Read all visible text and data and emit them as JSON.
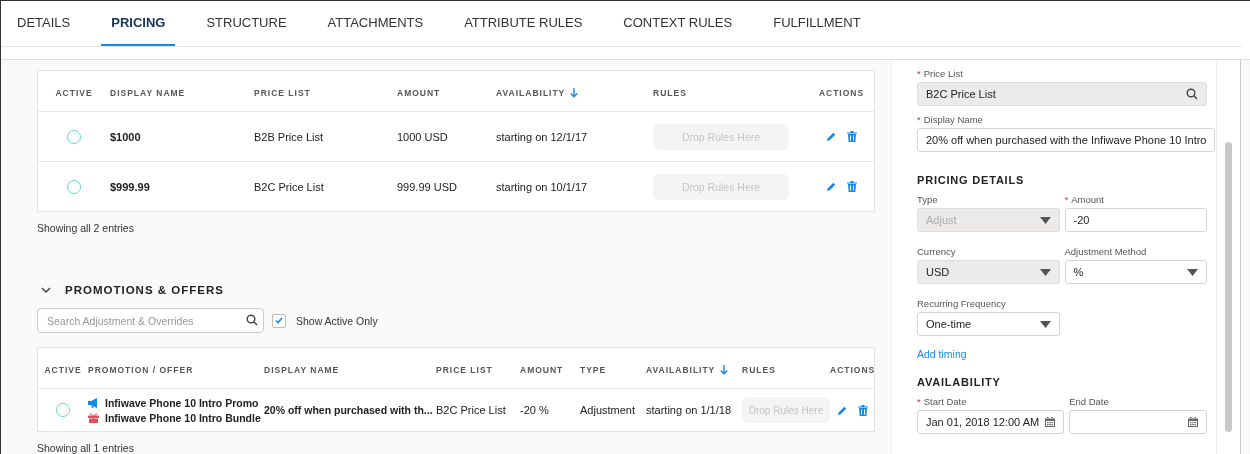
{
  "tabs": [
    {
      "label": "DETAILS",
      "selected": false
    },
    {
      "label": "PRICING",
      "selected": true
    },
    {
      "label": "STRUCTURE",
      "selected": false
    },
    {
      "label": "ATTACHMENTS",
      "selected": false
    },
    {
      "label": "ATTRIBUTE RULES",
      "selected": false
    },
    {
      "label": "CONTEXT RULES",
      "selected": false
    },
    {
      "label": "FULFILLMENT",
      "selected": false
    }
  ],
  "price_table": {
    "columns": [
      {
        "label": "ACTIVE",
        "sorted": false
      },
      {
        "label": "DISPLAY NAME",
        "sorted": false
      },
      {
        "label": "PRICE LIST",
        "sorted": false
      },
      {
        "label": "AMOUNT",
        "sorted": false
      },
      {
        "label": "AVAILABILITY",
        "sorted": true
      },
      {
        "label": "RULES",
        "sorted": false
      },
      {
        "label": "ACTIONS",
        "sorted": false
      }
    ],
    "rows": [
      {
        "active": false,
        "display_name": "$1000",
        "price_list": "B2B Price List",
        "amount": "1000 USD",
        "availability": "starting on 12/1/17",
        "rules": "Drop Rules Here"
      },
      {
        "active": false,
        "display_name": "$999.99",
        "price_list": "B2C Price List",
        "amount": "999.99 USD",
        "availability": "starting on 10/1/17",
        "rules": "Drop Rules Here"
      }
    ],
    "footer": "Showing all 2 entries"
  },
  "promotions": {
    "title": "PROMOTIONS & OFFERS",
    "expanded": true,
    "search": {
      "placeholder": "Search Adjustment & Overrides"
    },
    "show_active_only": {
      "label": "Show Active Only",
      "checked": true
    },
    "columns": [
      {
        "label": "ACTIVE",
        "sorted": false
      },
      {
        "label": "PROMOTION / OFFER",
        "sorted": false
      },
      {
        "label": "DISPLAY NAME",
        "sorted": false
      },
      {
        "label": "PRICE LIST",
        "sorted": false
      },
      {
        "label": "AMOUNT",
        "sorted": false
      },
      {
        "label": "TYPE",
        "sorted": false
      },
      {
        "label": "AVAILABILITY",
        "sorted": true
      },
      {
        "label": "RULES",
        "sorted": false
      },
      {
        "label": "ACTIONS",
        "sorted": false
      }
    ],
    "rows": [
      {
        "active": false,
        "offers": [
          {
            "kind": "promotion",
            "name": "Infiwave Phone 10 Intro Promo"
          },
          {
            "kind": "bundle",
            "name": "Infiwave Phone 10 Intro Bundle"
          }
        ],
        "display_name": "20% off when purchased with th...",
        "price_list": "B2C Price List",
        "amount": "-20 %",
        "type": "Adjustment",
        "availability": "starting on 1/1/18",
        "rules": "Drop Rules Here"
      }
    ],
    "footer": "Showing all 1 entries"
  },
  "detail_panel": {
    "required_mark": "*",
    "fields_top": [
      {
        "label": "Price List",
        "required": true,
        "kind": "lookup",
        "value": "B2C Price List",
        "disabled": false
      },
      {
        "label": "Display Name",
        "required": true,
        "kind": "text",
        "value": "20% off when purchased with the Infiwave Phone 10 Intro",
        "disabled": false
      }
    ],
    "pricing_title": "PRICING DETAILS",
    "pricing_rows": [
      [
        {
          "label": "Type",
          "required": false,
          "kind": "select",
          "value": "Adjust",
          "disabled": true
        },
        {
          "label": "Amount",
          "required": true,
          "kind": "text",
          "value": "-20",
          "disabled": false
        }
      ],
      [
        {
          "label": "Currency",
          "required": false,
          "kind": "select",
          "value": "USD",
          "disabled": false,
          "shaded": true
        },
        {
          "label": "Adjustment Method",
          "required": false,
          "kind": "select",
          "value": "%",
          "disabled": false
        }
      ],
      [
        {
          "label": "Recurring Frequency",
          "required": false,
          "kind": "select",
          "value": "One-time",
          "disabled": false
        }
      ]
    ],
    "link": "Add timing",
    "availability_title": "AVAILABILITY",
    "date_fields": [
      {
        "label": "Start Date",
        "required": true,
        "kind": "date",
        "value": "Jan 01, 2018 12:00 AM",
        "disabled": false
      },
      {
        "label": "End Date",
        "required": false,
        "kind": "date",
        "disabled": false
      }
    ]
  }
}
